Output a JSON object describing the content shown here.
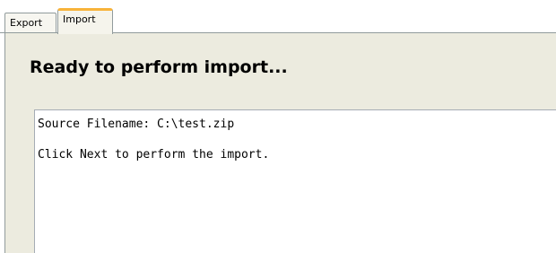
{
  "tabs": [
    {
      "label": "Export",
      "selected": false
    },
    {
      "label": "Import",
      "selected": true
    }
  ],
  "panel": {
    "heading": "Ready to perform import...",
    "summary_lines": [
      "Source Filename: C:\\test.zip",
      "",
      "Click Next to perform the import."
    ]
  },
  "colors": {
    "panel_background": "#ecebdf",
    "selected_tab_accent": "#f8b33a",
    "tab_border": "#919b9c"
  }
}
